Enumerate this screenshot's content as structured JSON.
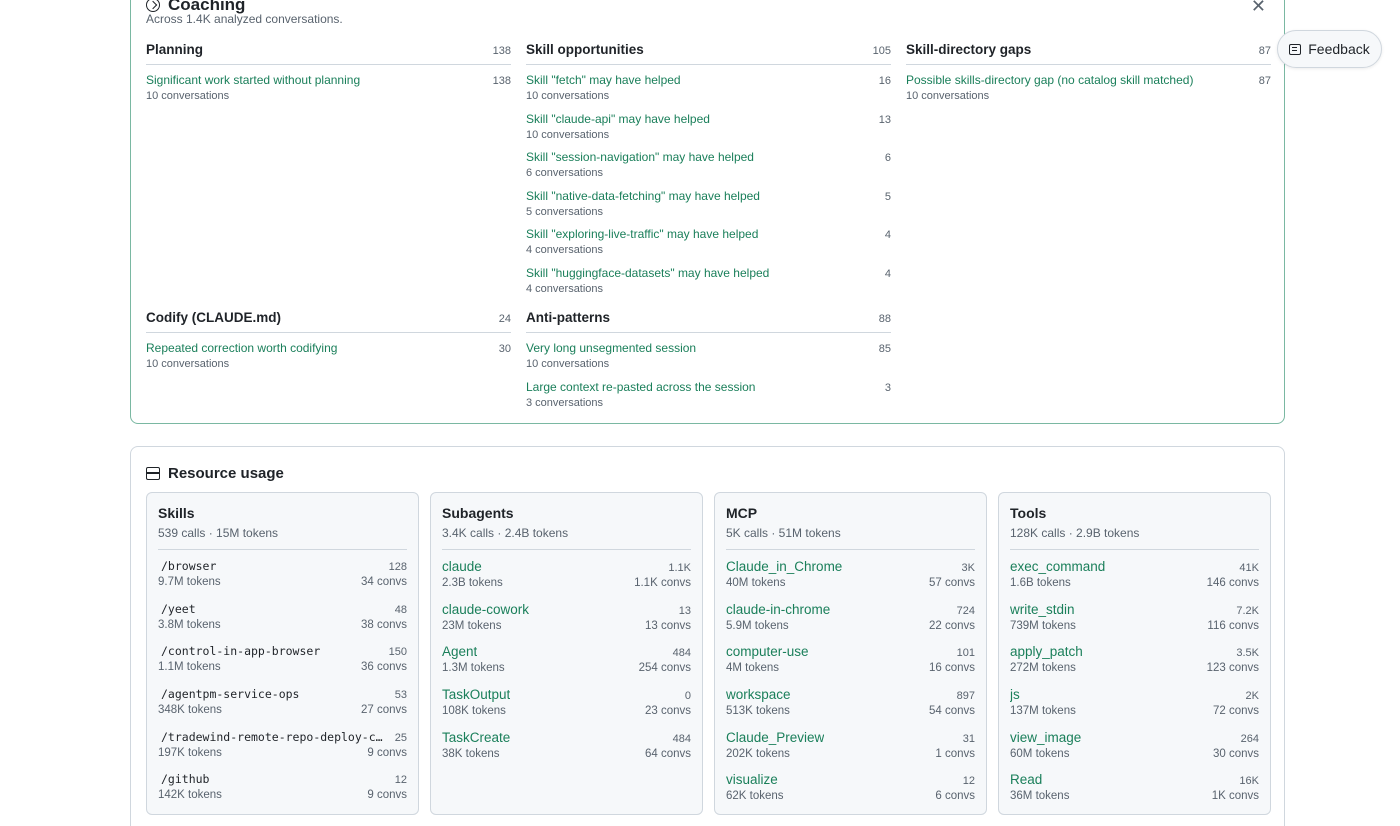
{
  "coaching": {
    "title": "Coaching",
    "subtitle": "Across 1.4K analyzed conversations.",
    "close_icon": "close-icon",
    "sections": {
      "planning": {
        "title": "Planning",
        "count": "138",
        "items": [
          {
            "label": "Significant work started without planning",
            "count": "138",
            "sub": "10 conversations"
          }
        ]
      },
      "skill_opportunities": {
        "title": "Skill opportunities",
        "count": "105",
        "items": [
          {
            "label": "Skill \"fetch\" may have helped",
            "count": "16",
            "sub": "10 conversations"
          },
          {
            "label": "Skill \"claude-api\" may have helped",
            "count": "13",
            "sub": "10 conversations"
          },
          {
            "label": "Skill \"session-navigation\" may have helped",
            "count": "6",
            "sub": "6 conversations"
          },
          {
            "label": "Skill \"native-data-fetching\" may have helped",
            "count": "5",
            "sub": "5 conversations"
          },
          {
            "label": "Skill \"exploring-live-traffic\" may have helped",
            "count": "4",
            "sub": "4 conversations"
          },
          {
            "label": "Skill \"huggingface-datasets\" may have helped",
            "count": "4",
            "sub": "4 conversations"
          }
        ]
      },
      "skill_directory_gaps": {
        "title": "Skill-directory gaps",
        "count": "87",
        "items": [
          {
            "label": "Possible skills-directory gap (no catalog skill matched)",
            "count": "87",
            "sub": "10 conversations"
          }
        ]
      },
      "codify": {
        "title": "Codify (CLAUDE.md)",
        "count": "24",
        "items": [
          {
            "label": "Repeated correction worth codifying",
            "count": "30",
            "sub": "10 conversations"
          }
        ]
      },
      "anti_patterns": {
        "title": "Anti-patterns",
        "count": "88",
        "items": [
          {
            "label": "Very long unsegmented session",
            "count": "85",
            "sub": "10 conversations"
          },
          {
            "label": "Large context re-pasted across the session",
            "count": "3",
            "sub": "3 conversations"
          }
        ]
      }
    }
  },
  "feedback": {
    "label": "Feedback",
    "icon": "message-icon"
  },
  "resource_usage": {
    "title": "Resource usage",
    "icon": "server-icon",
    "panels": {
      "skills": {
        "title": "Skills",
        "summary": "539 calls · 15M tokens",
        "items": [
          {
            "name": "/browser",
            "calls": "128",
            "tokens": "9.7M tokens",
            "convs": "34 convs"
          },
          {
            "name": "/yeet",
            "calls": "48",
            "tokens": "3.8M tokens",
            "convs": "38 convs"
          },
          {
            "name": "/control-in-app-browser",
            "calls": "150",
            "tokens": "1.1M tokens",
            "convs": "36 convs"
          },
          {
            "name": "/agentpm-service-ops",
            "calls": "53",
            "tokens": "348K tokens",
            "convs": "27 convs"
          },
          {
            "name": "/tradewind-remote-repo-deploy-c…",
            "calls": "25",
            "tokens": "197K tokens",
            "convs": "9 convs"
          },
          {
            "name": "/github",
            "calls": "12",
            "tokens": "142K tokens",
            "convs": "9 convs"
          }
        ]
      },
      "subagents": {
        "title": "Subagents",
        "summary": "3.4K calls · 2.4B tokens",
        "items": [
          {
            "name": "claude",
            "calls": "1.1K",
            "tokens": "2.3B tokens",
            "convs": "1.1K convs"
          },
          {
            "name": "claude-cowork",
            "calls": "13",
            "tokens": "23M tokens",
            "convs": "13 convs"
          },
          {
            "name": "Agent",
            "calls": "484",
            "tokens": "1.3M tokens",
            "convs": "254 convs"
          },
          {
            "name": "TaskOutput",
            "calls": "0",
            "tokens": "108K tokens",
            "convs": "23 convs"
          },
          {
            "name": "TaskCreate",
            "calls": "484",
            "tokens": "38K tokens",
            "convs": "64 convs"
          }
        ]
      },
      "mcp": {
        "title": "MCP",
        "summary": "5K calls · 51M tokens",
        "items": [
          {
            "name": "Claude_in_Chrome",
            "calls": "3K",
            "tokens": "40M tokens",
            "convs": "57 convs"
          },
          {
            "name": "claude-in-chrome",
            "calls": "724",
            "tokens": "5.9M tokens",
            "convs": "22 convs"
          },
          {
            "name": "computer-use",
            "calls": "101",
            "tokens": "4M tokens",
            "convs": "16 convs"
          },
          {
            "name": "workspace",
            "calls": "897",
            "tokens": "513K tokens",
            "convs": "54 convs"
          },
          {
            "name": "Claude_Preview",
            "calls": "31",
            "tokens": "202K tokens",
            "convs": "1 convs"
          },
          {
            "name": "visualize",
            "calls": "12",
            "tokens": "62K tokens",
            "convs": "6 convs"
          }
        ]
      },
      "tools": {
        "title": "Tools",
        "summary": "128K calls · 2.9B tokens",
        "items": [
          {
            "name": "exec_command",
            "calls": "41K",
            "tokens": "1.6B tokens",
            "convs": "146 convs"
          },
          {
            "name": "write_stdin",
            "calls": "7.2K",
            "tokens": "739M tokens",
            "convs": "116 convs"
          },
          {
            "name": "apply_patch",
            "calls": "3.5K",
            "tokens": "272M tokens",
            "convs": "123 convs"
          },
          {
            "name": "js",
            "calls": "2K",
            "tokens": "137M tokens",
            "convs": "72 convs"
          },
          {
            "name": "view_image",
            "calls": "264",
            "tokens": "60M tokens",
            "convs": "30 convs"
          },
          {
            "name": "Read",
            "calls": "16K",
            "tokens": "36M tokens",
            "convs": "1K convs"
          }
        ]
      }
    }
  }
}
